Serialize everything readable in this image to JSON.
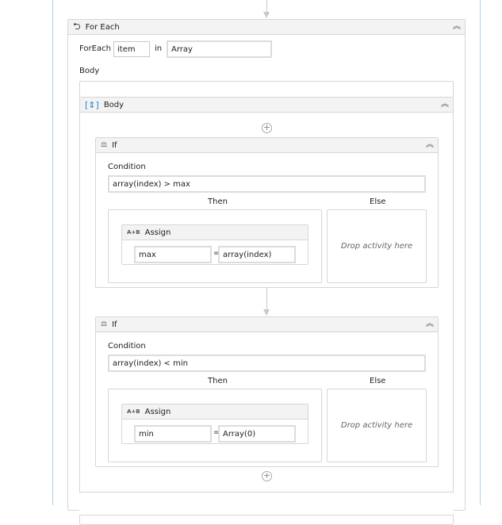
{
  "foreach": {
    "title": "For Each",
    "foreach_label": "ForEach",
    "item_value": "item",
    "in_label": "in",
    "array_value": "Array",
    "body_label": "Body"
  },
  "sequence": {
    "title": "Body"
  },
  "if_blocks": [
    {
      "title": "If",
      "condition_label": "Condition",
      "condition": "array(index) > max",
      "then_label": "Then",
      "else_label": "Else",
      "assign": {
        "title": "Assign",
        "to": "max",
        "eq": "=",
        "value": "array(index)"
      },
      "drop_text": "Drop activity here"
    },
    {
      "title": "If",
      "condition_label": "Condition",
      "condition": "array(index) < min",
      "then_label": "Then",
      "else_label": "Else",
      "assign": {
        "title": "Assign",
        "to": "min",
        "eq": "=",
        "value": "Array(0)"
      },
      "drop_text": "Drop activity here"
    }
  ],
  "icons": {
    "assign": "A+B",
    "plus": "+",
    "collapse": "︽"
  }
}
